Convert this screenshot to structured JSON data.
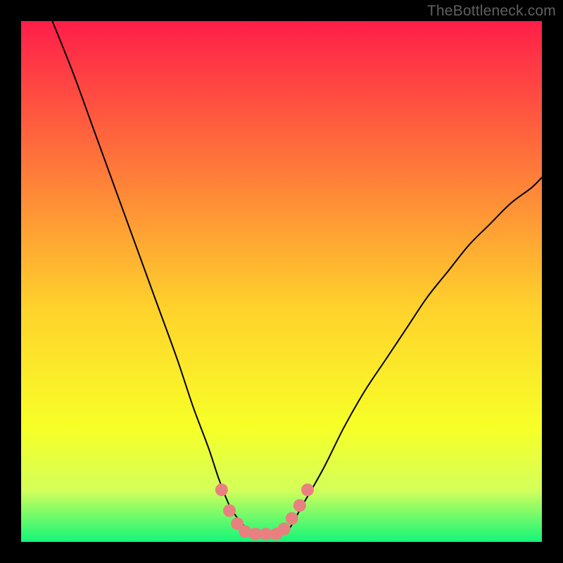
{
  "watermark": "TheBottleneck.com",
  "palette": {
    "background": "#000000",
    "gradient_top": "#ff1e49",
    "gradient_upper_mid": "#ff783a",
    "gradient_mid": "#ffd22c",
    "gradient_lower_mid": "#f7ff27",
    "gradient_low": "#d4ff5a",
    "gradient_bottom": "#13f57a",
    "curve": "#000000",
    "marker_fill": "#e98080",
    "marker_stroke": "#d06262"
  },
  "chart_data": {
    "type": "line",
    "title": "",
    "xlabel": "",
    "ylabel": "",
    "xlim": [
      0,
      100
    ],
    "ylim": [
      0,
      100
    ],
    "series": [
      {
        "name": "bottleneck-curve",
        "x": [
          6,
          10,
          14,
          18,
          22,
          26,
          30,
          33,
          36,
          38,
          40,
          42,
          44,
          46,
          48,
          51,
          54,
          58,
          62,
          66,
          70,
          74,
          78,
          82,
          86,
          90,
          94,
          98,
          100
        ],
        "y": [
          100,
          90,
          79,
          68,
          57,
          46,
          35,
          26,
          18,
          12,
          7,
          4,
          2,
          1.5,
          1.5,
          2,
          7,
          14,
          22,
          29,
          35,
          41,
          47,
          52,
          57,
          61,
          65,
          68,
          70
        ]
      }
    ],
    "markers": {
      "name": "highlight-points",
      "points": [
        {
          "x": 38.5,
          "y": 10
        },
        {
          "x": 40,
          "y": 6
        },
        {
          "x": 41.5,
          "y": 3.5
        },
        {
          "x": 43,
          "y": 2
        },
        {
          "x": 45,
          "y": 1.5
        },
        {
          "x": 47,
          "y": 1.5
        },
        {
          "x": 49,
          "y": 1.5
        },
        {
          "x": 50.5,
          "y": 2.5
        },
        {
          "x": 52,
          "y": 4.5
        },
        {
          "x": 53.5,
          "y": 7
        },
        {
          "x": 55,
          "y": 10
        }
      ]
    }
  }
}
